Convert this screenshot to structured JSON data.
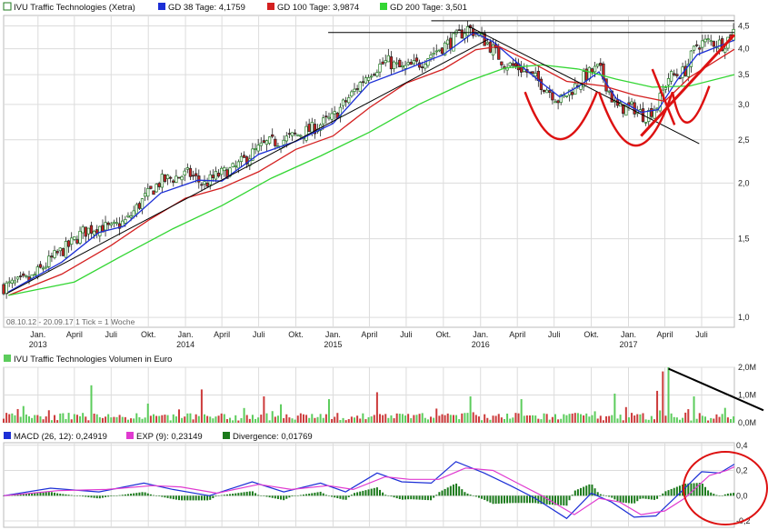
{
  "colors": {
    "bg": "#ffffff",
    "grid": "#dcdcdc",
    "up": "#1f7a1f",
    "down": "#cc2222",
    "gd38": "#1c2fd6",
    "gd100": "#d42020",
    "gd200": "#33d633",
    "macd": "#1c2fd6",
    "exp": "#e03ad0",
    "divergence": "#1b7a1b",
    "volume_up": "#5ccc5c",
    "volume_down": "#cc3b3b",
    "annotation_red": "#dd1111",
    "annotation_black": "#000000"
  },
  "legend_price": [
    {
      "icon": "title-swatch",
      "color": "#1f7a1f",
      "label": "IVU Traffic Technologies (Xetra)"
    },
    {
      "icon": "gd38-swatch",
      "color": "#1c2fd6",
      "label": "GD 38 Tage: 4,1759"
    },
    {
      "icon": "gd100-swatch",
      "color": "#d42020",
      "label": "GD 100 Tage: 3,9874"
    },
    {
      "icon": "gd200-swatch",
      "color": "#33d633",
      "label": "GD 200 Tage: 3,501"
    }
  ],
  "legend_volume": {
    "label": "IVU Traffic Technologies Volumen in Euro",
    "color": "#5ccc5c"
  },
  "legend_macd": [
    {
      "color": "#1c2fd6",
      "label": "MACD (26, 12): 0,24919"
    },
    {
      "color": "#e03ad0",
      "label": "EXP (9): 0,23149"
    },
    {
      "color": "#1b7a1b",
      "label": "Divergence: 0,01769"
    }
  ],
  "footer_note": "08.10.12 - 20.09.17   1 Tick = 1 Woche",
  "chart_data": [
    {
      "type": "candlestick",
      "title": "IVU Traffic Technologies (Xetra)",
      "scale": "log",
      "ylim": [
        0.95,
        4.75
      ],
      "y_ticks": [
        {
          "v": 1.0,
          "label": "1,0"
        },
        {
          "v": 1.5,
          "label": "1,5"
        },
        {
          "v": 2.0,
          "label": "2,0"
        },
        {
          "v": 2.5,
          "label": "2,5"
        },
        {
          "v": 3.0,
          "label": "3,0"
        },
        {
          "v": 3.5,
          "label": "3,5"
        },
        {
          "v": 4.0,
          "label": "4,0"
        },
        {
          "v": 4.5,
          "label": "4,5"
        }
      ],
      "x_start": "2012-10-08",
      "x_end": "2017-09-20",
      "x_ticks": [
        {
          "date": "2013-01-01",
          "label": "Jan.",
          "year": "2013"
        },
        {
          "date": "2013-04-01",
          "label": "April"
        },
        {
          "date": "2013-07-01",
          "label": "Juli"
        },
        {
          "date": "2013-10-01",
          "label": "Okt."
        },
        {
          "date": "2014-01-01",
          "label": "Jan.",
          "year": "2014"
        },
        {
          "date": "2014-04-01",
          "label": "April"
        },
        {
          "date": "2014-07-01",
          "label": "Juli"
        },
        {
          "date": "2014-10-01",
          "label": "Okt."
        },
        {
          "date": "2015-01-01",
          "label": "Jan.",
          "year": "2015"
        },
        {
          "date": "2015-04-01",
          "label": "April"
        },
        {
          "date": "2015-07-01",
          "label": "Juli"
        },
        {
          "date": "2015-10-01",
          "label": "Okt."
        },
        {
          "date": "2016-01-01",
          "label": "Jan.",
          "year": "2016"
        },
        {
          "date": "2016-04-01",
          "label": "April"
        },
        {
          "date": "2016-07-01",
          "label": "Juli"
        },
        {
          "date": "2016-10-01",
          "label": "Okt."
        },
        {
          "date": "2017-01-01",
          "label": "Jan.",
          "year": "2017"
        },
        {
          "date": "2017-04-01",
          "label": "April"
        },
        {
          "date": "2017-07-01",
          "label": "Juli"
        }
      ],
      "close_path": [
        [
          "2012-10-08",
          1.17
        ],
        [
          "2012-12-15",
          1.22
        ],
        [
          "2013-02-15",
          1.38
        ],
        [
          "2013-03-20",
          1.45
        ],
        [
          "2013-04-20",
          1.55
        ],
        [
          "2013-06-01",
          1.6
        ],
        [
          "2013-07-01",
          1.58
        ],
        [
          "2013-08-10",
          1.65
        ],
        [
          "2013-09-15",
          1.82
        ],
        [
          "2013-11-01",
          2.02
        ],
        [
          "2014-01-10",
          2.1
        ],
        [
          "2014-02-15",
          1.98
        ],
        [
          "2014-03-20",
          2.08
        ],
        [
          "2014-05-01",
          2.15
        ],
        [
          "2014-06-15",
          2.33
        ],
        [
          "2014-07-20",
          2.45
        ],
        [
          "2014-09-01",
          2.5
        ],
        [
          "2014-11-01",
          2.62
        ],
        [
          "2015-01-01",
          2.8
        ],
        [
          "2015-02-15",
          3.15
        ],
        [
          "2015-04-01",
          3.55
        ],
        [
          "2015-05-15",
          3.75
        ],
        [
          "2015-06-20",
          3.6
        ],
        [
          "2015-08-01",
          3.7
        ],
        [
          "2015-09-01",
          3.9
        ],
        [
          "2015-10-20",
          4.15
        ],
        [
          "2015-12-01",
          4.45
        ],
        [
          "2015-12-20",
          4.35
        ],
        [
          "2016-01-20",
          4.1
        ],
        [
          "2016-03-01",
          3.7
        ],
        [
          "2016-04-15",
          3.6
        ],
        [
          "2016-06-15",
          3.25
        ],
        [
          "2016-07-15",
          3.05
        ],
        [
          "2016-08-15",
          3.25
        ],
        [
          "2016-09-20",
          3.5
        ],
        [
          "2016-10-20",
          3.62
        ],
        [
          "2016-11-15",
          3.2
        ],
        [
          "2016-12-01",
          2.95
        ],
        [
          "2017-01-15",
          2.95
        ],
        [
          "2017-02-10",
          2.82
        ],
        [
          "2017-03-15",
          3.0
        ],
        [
          "2017-04-10",
          3.45
        ],
        [
          "2017-05-20",
          3.55
        ],
        [
          "2017-06-20",
          4.1
        ],
        [
          "2017-07-20",
          4.15
        ],
        [
          "2017-08-25",
          4.1
        ],
        [
          "2017-09-20",
          4.4
        ]
      ],
      "series": [
        {
          "name": "GD 38 Tage",
          "color": "#1c2fd6",
          "points": [
            [
              "2012-10-20",
              1.14
            ],
            [
              "2013-03-01",
              1.33
            ],
            [
              "2013-06-01",
              1.55
            ],
            [
              "2013-08-01",
              1.6
            ],
            [
              "2013-11-01",
              1.9
            ],
            [
              "2014-02-01",
              2.03
            ],
            [
              "2014-04-01",
              2.02
            ],
            [
              "2014-07-01",
              2.32
            ],
            [
              "2014-10-01",
              2.48
            ],
            [
              "2015-01-01",
              2.72
            ],
            [
              "2015-04-01",
              3.35
            ],
            [
              "2015-07-01",
              3.6
            ],
            [
              "2015-10-01",
              3.88
            ],
            [
              "2015-12-15",
              4.35
            ],
            [
              "2016-02-01",
              4.15
            ],
            [
              "2016-04-01",
              3.72
            ],
            [
              "2016-06-01",
              3.35
            ],
            [
              "2016-07-15",
              3.12
            ],
            [
              "2016-09-01",
              3.3
            ],
            [
              "2016-10-20",
              3.55
            ],
            [
              "2016-12-01",
              3.1
            ],
            [
              "2017-02-01",
              2.88
            ],
            [
              "2017-03-15",
              2.92
            ],
            [
              "2017-05-01",
              3.4
            ],
            [
              "2017-06-20",
              3.88
            ],
            [
              "2017-09-20",
              4.18
            ]
          ]
        },
        {
          "name": "GD 100 Tage",
          "color": "#d42020",
          "points": [
            [
              "2012-10-20",
              1.12
            ],
            [
              "2013-03-01",
              1.25
            ],
            [
              "2013-07-01",
              1.45
            ],
            [
              "2013-10-01",
              1.65
            ],
            [
              "2014-01-01",
              1.85
            ],
            [
              "2014-04-01",
              1.95
            ],
            [
              "2014-07-01",
              2.12
            ],
            [
              "2014-10-01",
              2.38
            ],
            [
              "2015-01-01",
              2.55
            ],
            [
              "2015-04-01",
              2.95
            ],
            [
              "2015-07-01",
              3.35
            ],
            [
              "2015-10-01",
              3.6
            ],
            [
              "2015-12-20",
              3.98
            ],
            [
              "2016-02-15",
              4.05
            ],
            [
              "2016-05-01",
              3.75
            ],
            [
              "2016-08-01",
              3.38
            ],
            [
              "2016-11-01",
              3.3
            ],
            [
              "2017-01-15",
              3.15
            ],
            [
              "2017-04-01",
              3.05
            ],
            [
              "2017-06-01",
              3.45
            ],
            [
              "2017-09-20",
              3.99
            ]
          ]
        },
        {
          "name": "GD 200 Tage",
          "color": "#33d633",
          "points": [
            [
              "2012-10-20",
              1.12
            ],
            [
              "2013-04-01",
              1.2
            ],
            [
              "2013-08-01",
              1.38
            ],
            [
              "2013-12-01",
              1.58
            ],
            [
              "2014-04-01",
              1.78
            ],
            [
              "2014-08-01",
              2.05
            ],
            [
              "2014-12-01",
              2.3
            ],
            [
              "2015-04-01",
              2.6
            ],
            [
              "2015-08-01",
              3.0
            ],
            [
              "2015-12-01",
              3.38
            ],
            [
              "2016-03-01",
              3.62
            ],
            [
              "2016-06-01",
              3.68
            ],
            [
              "2016-09-01",
              3.6
            ],
            [
              "2016-12-01",
              3.42
            ],
            [
              "2017-03-01",
              3.28
            ],
            [
              "2017-06-01",
              3.3
            ],
            [
              "2017-09-20",
              3.5
            ]
          ]
        }
      ]
    },
    {
      "type": "bar",
      "title": "IVU Traffic Technologies Volumen in Euro",
      "ylim": [
        0,
        2.0
      ],
      "y_ticks": [
        {
          "v": 0,
          "label": "0,0M"
        },
        {
          "v": 1,
          "label": "1,0M"
        },
        {
          "v": 2,
          "label": "2,0M"
        }
      ],
      "spikes": [
        [
          "2013-05-15",
          1.35
        ],
        [
          "2014-02-10",
          1.2
        ],
        [
          "2014-07-15",
          0.95
        ],
        [
          "2014-12-20",
          0.85
        ],
        [
          "2015-04-20",
          1.1
        ],
        [
          "2015-12-10",
          0.95
        ],
        [
          "2016-04-10",
          0.85
        ],
        [
          "2016-11-25",
          1.05
        ],
        [
          "2017-03-10",
          1.15
        ],
        [
          "2017-03-25",
          1.85
        ],
        [
          "2017-04-08",
          2.0
        ],
        [
          "2017-06-15",
          0.95
        ]
      ]
    },
    {
      "type": "line",
      "title": "MACD",
      "ylim": [
        -0.25,
        0.42
      ],
      "y_ticks": [
        {
          "v": 0.4,
          "label": "0,4"
        },
        {
          "v": 0.2,
          "label": "0,2"
        },
        {
          "v": 0.0,
          "label": "0,0"
        },
        {
          "v": -0.2,
          "label": "-0,2"
        }
      ],
      "series": [
        {
          "name": "MACD (26, 12)",
          "color": "#1c2fd6",
          "points": [
            [
              "2012-10-08",
              0.0
            ],
            [
              "2013-02-01",
              0.06
            ],
            [
              "2013-06-01",
              0.03
            ],
            [
              "2013-09-20",
              0.1
            ],
            [
              "2013-12-01",
              0.05
            ],
            [
              "2014-03-01",
              0.0
            ],
            [
              "2014-06-15",
              0.11
            ],
            [
              "2014-09-01",
              0.03
            ],
            [
              "2014-12-01",
              0.1
            ],
            [
              "2015-02-01",
              0.03
            ],
            [
              "2015-04-20",
              0.18
            ],
            [
              "2015-06-20",
              0.11
            ],
            [
              "2015-09-01",
              0.1
            ],
            [
              "2015-11-01",
              0.27
            ],
            [
              "2016-01-10",
              0.18
            ],
            [
              "2016-03-15",
              0.08
            ],
            [
              "2016-05-15",
              -0.02
            ],
            [
              "2016-08-01",
              -0.18
            ],
            [
              "2016-10-01",
              0.02
            ],
            [
              "2016-11-20",
              -0.05
            ],
            [
              "2017-01-15",
              -0.17
            ],
            [
              "2017-03-10",
              -0.16
            ],
            [
              "2017-05-01",
              0.0
            ],
            [
              "2017-07-01",
              0.19
            ],
            [
              "2017-08-15",
              0.18
            ],
            [
              "2017-09-20",
              0.25
            ]
          ]
        },
        {
          "name": "EXP (9)",
          "color": "#e03ad0",
          "points": [
            [
              "2012-10-08",
              0.0
            ],
            [
              "2013-02-20",
              0.04
            ],
            [
              "2013-06-20",
              0.05
            ],
            [
              "2013-10-10",
              0.08
            ],
            [
              "2013-12-20",
              0.07
            ],
            [
              "2014-03-20",
              0.02
            ],
            [
              "2014-07-01",
              0.09
            ],
            [
              "2014-09-20",
              0.05
            ],
            [
              "2014-12-20",
              0.08
            ],
            [
              "2015-02-20",
              0.05
            ],
            [
              "2015-05-10",
              0.15
            ],
            [
              "2015-07-10",
              0.13
            ],
            [
              "2015-09-20",
              0.13
            ],
            [
              "2015-11-25",
              0.22
            ],
            [
              "2016-02-01",
              0.2
            ],
            [
              "2016-04-01",
              0.1
            ],
            [
              "2016-06-01",
              0.0
            ],
            [
              "2016-08-20",
              -0.15
            ],
            [
              "2016-10-20",
              -0.02
            ],
            [
              "2016-12-10",
              -0.05
            ],
            [
              "2017-02-01",
              -0.15
            ],
            [
              "2017-04-01",
              -0.12
            ],
            [
              "2017-05-20",
              -0.02
            ],
            [
              "2017-07-20",
              0.16
            ],
            [
              "2017-09-01",
              0.2
            ],
            [
              "2017-09-20",
              0.23
            ]
          ]
        }
      ]
    }
  ],
  "annotations": {
    "note": "hand-drawn trend lines, head-and-shoulders arcs and circle"
  }
}
